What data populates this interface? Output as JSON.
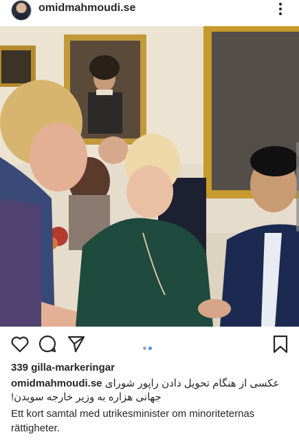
{
  "header": {
    "username": "omidmahmoudi.se",
    "avatar_icon": "profile-avatar",
    "more_icon": "more-options-icon"
  },
  "post": {
    "image_description_icon": "post-photo",
    "carousel_total": 2,
    "carousel_active": 2
  },
  "actions": {
    "like_icon": "heart-icon",
    "comment_icon": "comment-icon",
    "share_icon": "send-icon",
    "save_icon": "bookmark-icon"
  },
  "likes": {
    "text": "339 gilla-markeringar"
  },
  "caption": {
    "username": "omidmahmoudi.se",
    "persian_line1": "عکسی از هنگام تحویل دادن راپور شورای",
    "persian_line2": "جهانی هزاره به وزیر خارجه سویدن!",
    "swedish": "Ett kort samtal med utrikesminister om minoriteternas rättigheter."
  },
  "colors": {
    "text": "#262626",
    "dot_active": "#3897f0",
    "dot_inactive": "#a8a8a8"
  }
}
